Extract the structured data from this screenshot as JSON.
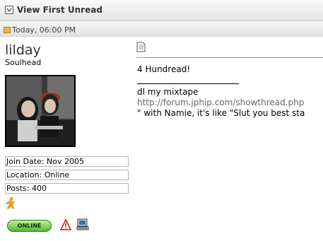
{
  "title_bar": {
    "label": "View First Unread"
  },
  "post": {
    "date": "Today, 06:00 PM"
  },
  "user": {
    "name": "lilday",
    "title": "Soulhead",
    "join_date": "Join Date: Nov 2005",
    "location": "Location: Online",
    "posts": "Posts: 400",
    "status": "ONLINE"
  },
  "message": {
    "line1": "4 Hundread!",
    "sig_line1": "dl my mixtape",
    "sig_link": "http://forum.jphip.com/showthread.php",
    "sig_line3": "\" with Namie, it's like \"Slut you best sta"
  },
  "icons": {
    "title": "thread-icon",
    "post": "post-icon",
    "message": "message-icon",
    "aim": "aim-icon",
    "report": "report-icon",
    "ip": "computer-icon"
  },
  "colors": {
    "title_bar": "#e4e4e4",
    "online_badge": "#55b53a",
    "link": "#666666"
  }
}
